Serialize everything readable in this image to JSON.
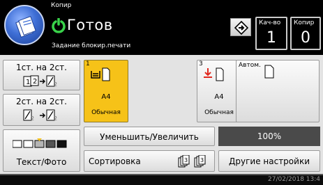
{
  "header": {
    "app_title": "Копир",
    "status": "Готов",
    "status_sub": "Задание блокир.печати",
    "quantity_label": "Кач-во",
    "quantity_value": "1",
    "copies_label": "Копир",
    "copies_value": "0"
  },
  "duplex": {
    "one_to_two": "1ст. на 2ст.",
    "two_to_two": "2ст. на 2ст."
  },
  "mode": {
    "label": "Текст/Фото"
  },
  "trays": [
    {
      "number": "1",
      "size": "A4",
      "type": "Обычная",
      "selected": true
    },
    {
      "number": "3",
      "size": "A4",
      "type": "Обычная",
      "selected": false
    }
  ],
  "auto_tray": {
    "label": "Автом."
  },
  "reduce_enlarge": {
    "label": "Уменьшить/Увеличить",
    "ratio": "100%"
  },
  "sort": {
    "label": "Сортировка"
  },
  "other_settings": {
    "label": "Другие настройки"
  },
  "statusbar": {
    "datetime": "27/02/2018 13:4"
  },
  "colors": {
    "selected_tray": "#f6c218",
    "status_green": "#39d24a",
    "icon_blue": "#3f6fd6"
  }
}
